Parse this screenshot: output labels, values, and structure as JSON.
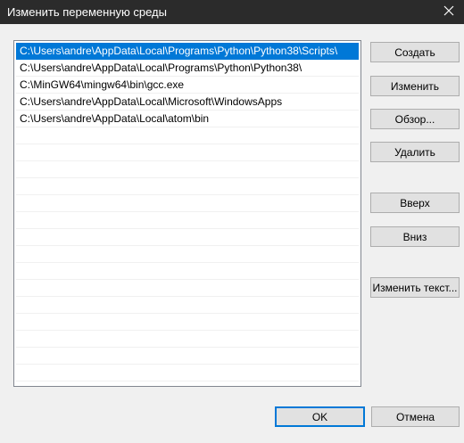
{
  "window": {
    "title": "Изменить переменную среды"
  },
  "list": {
    "items": [
      "C:\\Users\\andre\\AppData\\Local\\Programs\\Python\\Python38\\Scripts\\",
      "C:\\Users\\andre\\AppData\\Local\\Programs\\Python\\Python38\\",
      "C:\\MinGW64\\mingw64\\bin\\gcc.exe",
      "C:\\Users\\andre\\AppData\\Local\\Microsoft\\WindowsApps",
      "C:\\Users\\andre\\AppData\\Local\\atom\\bin"
    ],
    "selected_index": 0
  },
  "buttons": {
    "create": "Создать",
    "edit": "Изменить",
    "browse": "Обзор...",
    "delete": "Удалить",
    "up": "Вверх",
    "down": "Вниз",
    "edit_text": "Изменить текст...",
    "ok": "OK",
    "cancel": "Отмена"
  },
  "colors": {
    "selection": "#0078d7",
    "titlebar": "#2b2b2b"
  }
}
